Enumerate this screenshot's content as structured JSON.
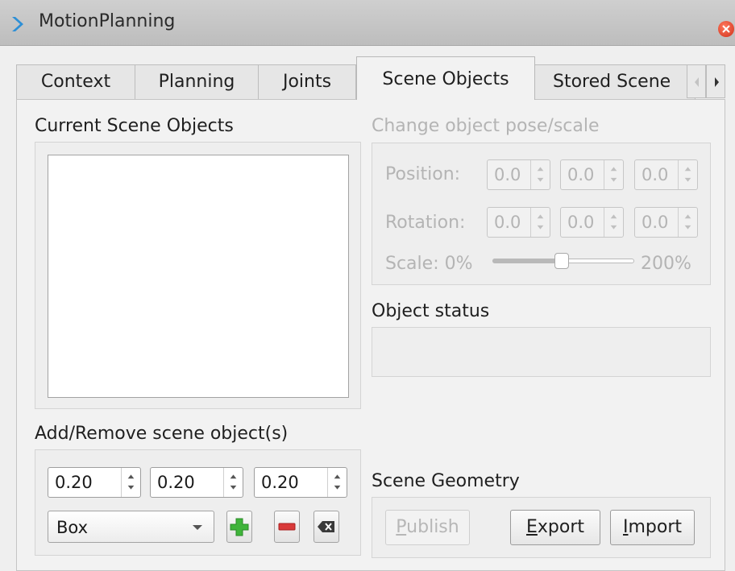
{
  "window": {
    "title": "MotionPlanning"
  },
  "tabs": [
    {
      "label": "Context"
    },
    {
      "label": "Planning"
    },
    {
      "label": "Joints"
    },
    {
      "label": "Scene Objects",
      "active": true
    },
    {
      "label": "Stored Scene"
    }
  ],
  "current_objects": {
    "label": "Current Scene Objects"
  },
  "add_remove": {
    "label": "Add/Remove scene object(s)",
    "size_x": "0.20",
    "size_y": "0.20",
    "size_z": "0.20",
    "shape": "Box"
  },
  "pose": {
    "label": "Change object pose/scale",
    "position_label": "Position:",
    "position": [
      "0.0",
      "0.0",
      "0.0"
    ],
    "rotation_label": "Rotation:",
    "rotation": [
      "0.0",
      "0.0",
      "0.0"
    ],
    "scale_label": "Scale: 0%",
    "scale_max": "200%",
    "scale_value_fraction": 0.5
  },
  "status": {
    "label": "Object status"
  },
  "geometry": {
    "label": "Scene Geometry",
    "publish_mn": "P",
    "publish_rest": "ublish",
    "export_mn": "E",
    "export_rest": "xport",
    "import_mn": "I",
    "import_rest": "mport"
  },
  "colors": {
    "add_icon": "#3fb43a",
    "remove_icon": "#d93a3a",
    "close_button": "#d0301b",
    "chevron": "#2d8fd6"
  }
}
